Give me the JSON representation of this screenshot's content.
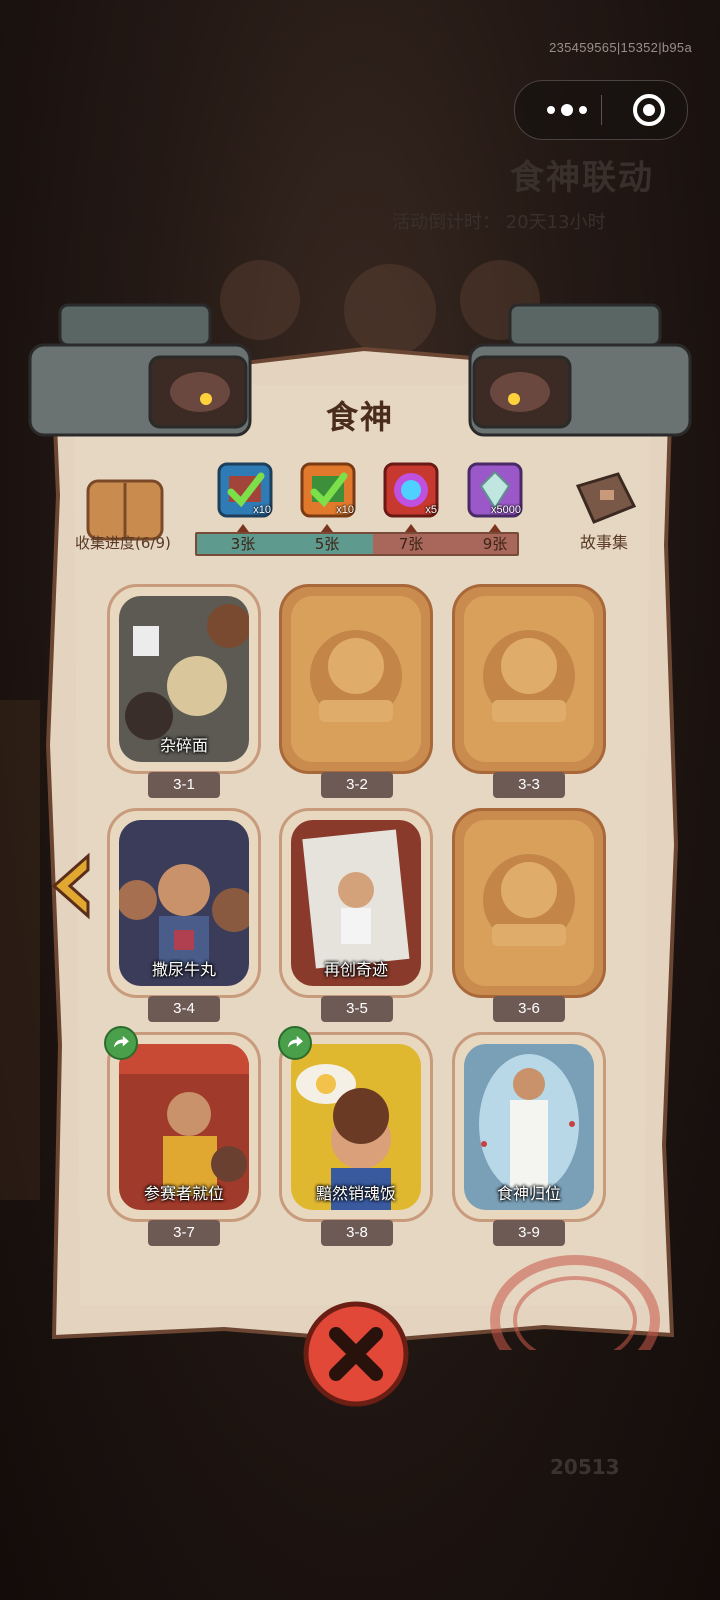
{
  "system": {
    "device_id": "235459565|15352|b95a"
  },
  "background": {
    "event_title": "食神联动",
    "event_subtitle": "活动倒计时： 20天13小时",
    "coin_count": "20513"
  },
  "panel": {
    "title": "食神",
    "collect_label": "收集进度(6/9)",
    "story_label": "故事集",
    "progress_fraction": 0.55
  },
  "rewards": [
    {
      "icon": "green-ticket-icon",
      "qty": "x10",
      "milestone": "3张",
      "claimed": true
    },
    {
      "icon": "orange-ticket-icon",
      "qty": "x10",
      "milestone": "5张",
      "claimed": true
    },
    {
      "icon": "rainbow-orb-icon",
      "qty": "x5",
      "milestone": "7张",
      "claimed": false
    },
    {
      "icon": "diamond-icon",
      "qty": "x5000",
      "milestone": "9张",
      "claimed": false
    }
  ],
  "cards": [
    {
      "id": "3-1",
      "title": "杂碎面",
      "unlocked": true,
      "share": false
    },
    {
      "id": "3-2",
      "title": "",
      "unlocked": false,
      "share": false
    },
    {
      "id": "3-3",
      "title": "",
      "unlocked": false,
      "share": false
    },
    {
      "id": "3-4",
      "title": "撒尿牛丸",
      "unlocked": true,
      "share": false
    },
    {
      "id": "3-5",
      "title": "再创奇迹",
      "unlocked": true,
      "share": false
    },
    {
      "id": "3-6",
      "title": "",
      "unlocked": false,
      "share": false
    },
    {
      "id": "3-7",
      "title": "参赛者就位",
      "unlocked": true,
      "share": true
    },
    {
      "id": "3-8",
      "title": "黯然销魂饭",
      "unlocked": true,
      "share": true
    },
    {
      "id": "3-9",
      "title": "食神归位",
      "unlocked": true,
      "share": false
    }
  ]
}
